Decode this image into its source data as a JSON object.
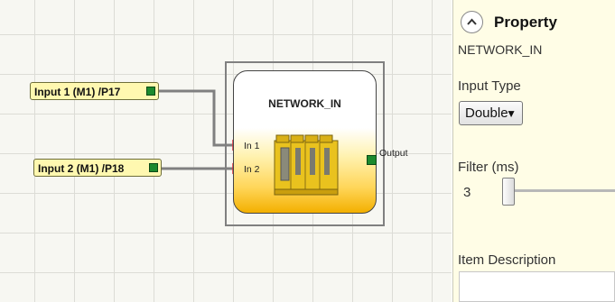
{
  "canvas": {
    "inputs": [
      {
        "label": "Input 1 (M1) /P17"
      },
      {
        "label": "Input 2 (M1) /P18"
      }
    ],
    "block": {
      "title": "NETWORK_IN",
      "in1_label": "In 1",
      "in2_label": "In 2",
      "output_label": "Output"
    }
  },
  "panel": {
    "title": "Property",
    "subtitle": "NETWORK_IN",
    "input_type_label": "Input Type",
    "input_type_value": "Double",
    "filter_label": "Filter (ms)",
    "filter_value": "3",
    "item_description_label": "Item Description",
    "item_description_value": ""
  },
  "colors": {
    "pin_green": "#1c8a2e",
    "input_fill": "#fff8b0",
    "block_orange": "#f3b000",
    "panel_bg": "#fffde6",
    "wire": "#808080",
    "in_arrow": "#e0303a"
  },
  "icons": {
    "collapse": "chevron-up-in-circle",
    "module": "safety-controller-modules",
    "dropdown": "triangle-down"
  }
}
